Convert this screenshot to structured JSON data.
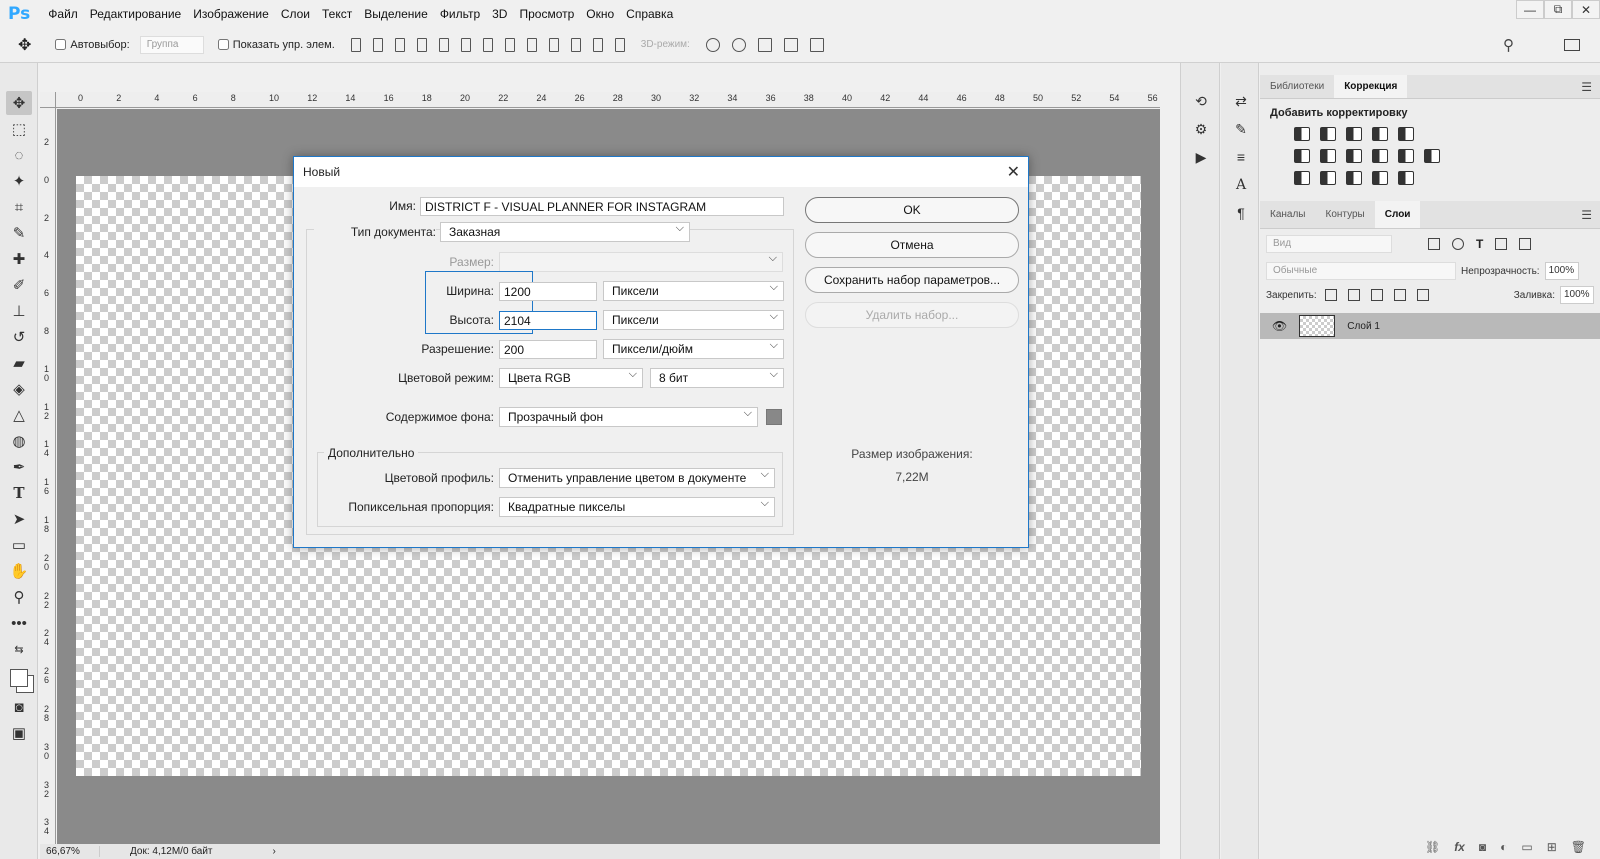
{
  "app": {
    "logo": "Ps",
    "title_menu": [
      "Файл",
      "Редактирование",
      "Изображение",
      "Слои",
      "Текст",
      "Выделение",
      "Фильтр",
      "3D",
      "Просмотр",
      "Окно",
      "Справка"
    ]
  },
  "window_controls": {
    "minimize": "—",
    "restore": "⧉",
    "close": "✕"
  },
  "options_bar": {
    "auto_select": "Автовыбор:",
    "group_select": "Группа",
    "show_transform": "Показать упр. элем.",
    "mode_3d": "3D-режим:"
  },
  "ruler": {
    "top": [
      "0",
      "2",
      "4",
      "6",
      "8",
      "10",
      "12",
      "14",
      "16",
      "18",
      "20",
      "22",
      "24",
      "26",
      "28",
      "30",
      "32",
      "34",
      "36",
      "38",
      "40",
      "42",
      "44",
      "46",
      "48",
      "50",
      "52",
      "54",
      "56"
    ],
    "left": [
      "2",
      "0",
      "2",
      "4",
      "6",
      "8",
      "1\n0",
      "1\n2",
      "1\n4",
      "1\n6",
      "1\n8",
      "2\n0",
      "2\n2",
      "2\n4",
      "2\n6",
      "2\n8",
      "3\n0",
      "3\n2",
      "3\n4"
    ]
  },
  "status": {
    "zoom": "66,67%",
    "doc": "Док: 4,12M/0 байт"
  },
  "right_panel": {
    "top_tabs": [
      "Библиотеки",
      "Коррекция"
    ],
    "corrections_title": "Добавить корректировку",
    "layer_tabs": [
      "Каналы",
      "Контуры",
      "Слои"
    ],
    "filter_kind": "Вид",
    "blend_mode": "Обычные",
    "opacity_label": "Непрозрачность:",
    "opacity_value": "100%",
    "lock_label": "Закрепить:",
    "fill_label": "Заливка:",
    "fill_value": "100%",
    "layer_name": "Слой 1",
    "bottom_icons": [
      "fx"
    ]
  },
  "dialog": {
    "title": "Новый",
    "name_label": "Имя:",
    "name_value": "DISTRICT F -  VISUAL PLANNER FOR INSTAGRAM",
    "doc_type_label": "Тип документа:",
    "doc_type_value": "Заказная",
    "size_label": "Размер:",
    "width_label": "Ширина:",
    "width_value": "1200",
    "width_unit": "Пиксели",
    "height_label": "Высота:",
    "height_value": "2104",
    "height_unit": "Пиксели",
    "resolution_label": "Разрешение:",
    "resolution_value": "200",
    "resolution_unit": "Пиксели/дюйм",
    "color_mode_label": "Цветовой режим:",
    "color_mode_value": "Цвета RGB",
    "bit_depth": "8 бит",
    "bg_label": "Содержимое фона:",
    "bg_value": "Прозрачный фон",
    "bg_swatch": "#888888",
    "advanced_label": "Дополнительно",
    "profile_label": "Цветовой профиль:",
    "profile_value": "Отменить управление цветом в документе",
    "pixel_aspect_label": "Попиксельная пропорция:",
    "pixel_aspect_value": "Квадратные пикселы",
    "ok": "OK",
    "cancel": "Отмена",
    "save_preset": "Сохранить набор параметров...",
    "delete_preset": "Удалить набор...",
    "image_size_label": "Размер изображения:",
    "image_size_value": "7,22M"
  }
}
